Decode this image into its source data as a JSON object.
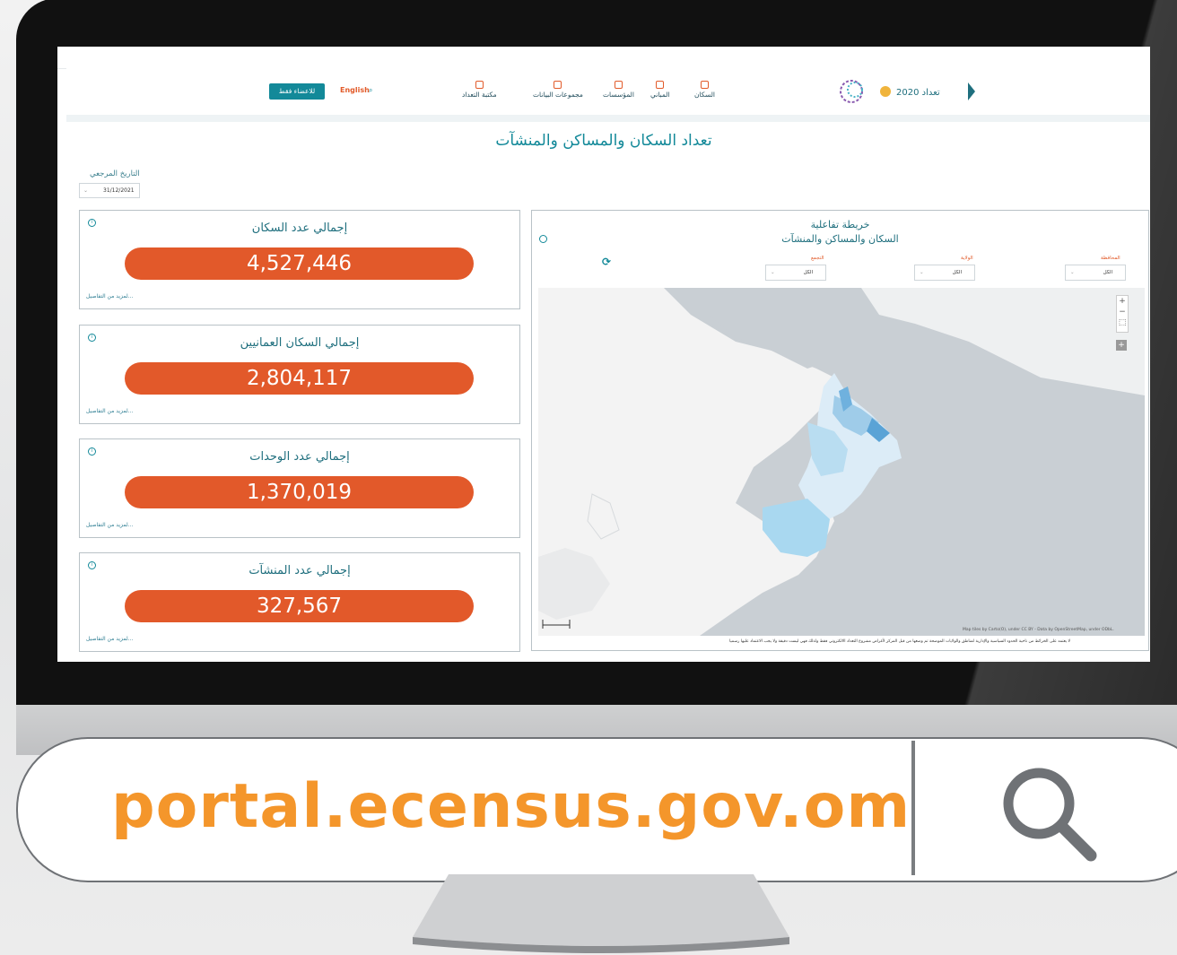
{
  "header": {
    "members_button": "للاعضاء فقط",
    "language": "English",
    "nav": [
      "السكان",
      "المباني",
      "المؤسسات",
      "مجموعات البيانات",
      "مكتبة التعداد"
    ],
    "logo_text": "تعداد 2020"
  },
  "page_title": "تعداد السكان والمساكن والمنشآت",
  "reference_date": {
    "label": "التاريخ المرجعي",
    "value": "31/12/2021"
  },
  "cards": [
    {
      "title": "إجمالي عدد السكان",
      "value": "4,527,446",
      "more": "لمزيد من التفاصيل..."
    },
    {
      "title": "إجمالي السكان العمانيين",
      "value": "2,804,117",
      "more": "لمزيد من التفاصيل..."
    },
    {
      "title": "إجمالي عدد الوحدات",
      "value": "1,370,019",
      "more": "لمزيد من التفاصيل..."
    },
    {
      "title": "إجمالي عدد المنشآت",
      "value": "327,567",
      "more": "لمزيد من التفاصيل..."
    }
  ],
  "map": {
    "title_line1": "خريطة تفاعلية",
    "title_line2": "السكان والمساكن والمنشآت",
    "filters": [
      {
        "label": "المحافظة",
        "value": "الكل"
      },
      {
        "label": "الولاية",
        "value": "الكل"
      },
      {
        "label": "التجمع",
        "value": "الكل"
      }
    ],
    "credits": "Map tiles by Carto(O), under CC BY - Data by OpenStreetMap, under ODbL.",
    "disclaimer": "لا يعتمد على الخرائط من ناحية الحدود السياسية والإدارية لمناطق والولايات الموضحة تم وضعها من قبل المركز لأغراض مشروع التعداد الالكتروني فقط ولذلك فهي ليست دقيقة ولا يجب الاعتماد عليها رسميا"
  },
  "url": "portal.ecensus.gov.om",
  "colors": {
    "accent": "#e2592a",
    "teal": "#138999",
    "url": "#f4962b"
  }
}
